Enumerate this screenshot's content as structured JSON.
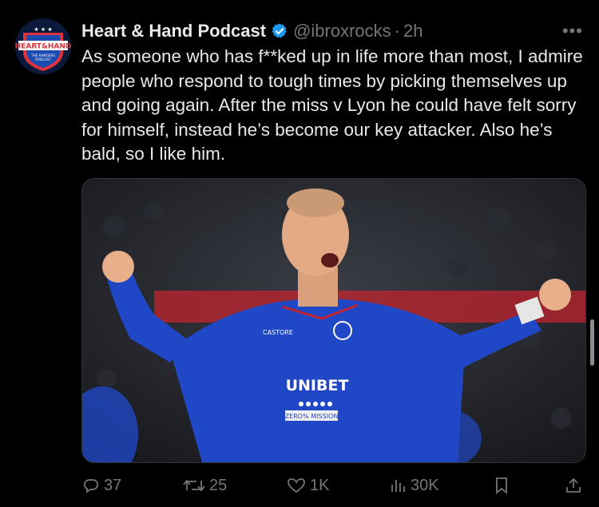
{
  "tweet": {
    "display_name": "Heart & Hand Podcast",
    "handle": "@ibroxrocks",
    "separator": "·",
    "time": "2h",
    "more_label": "•••",
    "text": "As someone who has f**ked up in life more than most, I admire people who respond to tough times by picking themselves up and going again. After the miss v Lyon he could have felt sorry for himself, instead he’s become our key attacker. Also he’s bald, so I like him."
  },
  "avatar": {
    "logo_text": "HEART&HAND",
    "logo_subtext": "THE RANGERS PODCAST",
    "colors": {
      "background": "#0b1a3a",
      "shield_red": "#e0323c",
      "shield_blue": "#1a4bb0"
    }
  },
  "media": {
    "jersey_sponsor": "UNIBET",
    "jersey_brand": "CASTORE",
    "jersey_sleeve_text": "ZERO% MISSION",
    "colors": {
      "kit_blue": "#1f47c6",
      "crowd_dark": "#1c1d22",
      "ad_red": "#c0242f"
    }
  },
  "actions": {
    "replies": "37",
    "retweets": "25",
    "likes": "1K",
    "views": "30K"
  },
  "colors": {
    "text": "#e7e9ea",
    "muted": "#71767b",
    "verified": "#1d9bf0",
    "background": "#000000"
  }
}
